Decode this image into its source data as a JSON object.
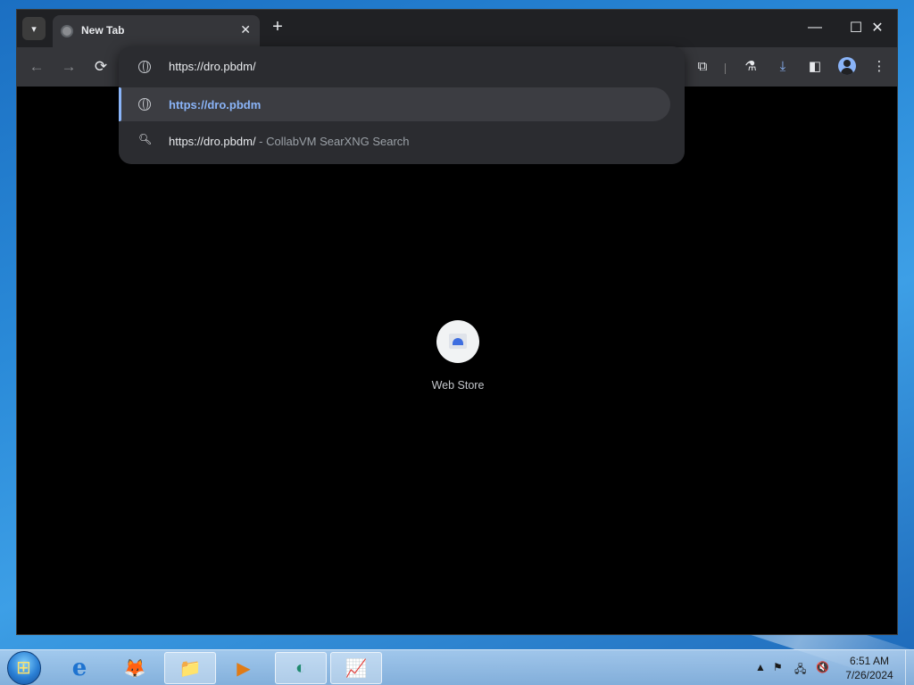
{
  "browser": {
    "tab": {
      "title": "New Tab",
      "close_icon": "✕"
    },
    "new_tab_icon": "+",
    "window_controls": {
      "minimize": "—",
      "maximize": "☐",
      "close": "✕"
    },
    "toolbar": {
      "back": "←",
      "forward": "→",
      "reload": "⟳",
      "extensions_icon": "⧉",
      "labs_icon": "⚗",
      "download_icon": "⤓",
      "side_panel_icon": "◧",
      "menu_icon": "⋮"
    },
    "omnibox": {
      "input_value": "https://dro.pbdm/",
      "suggestions": [
        {
          "text": "https://dro.pbdm",
          "icon": "globe-icon"
        },
        {
          "text": "https://dro.pbdm/",
          "tail": " - CollabVM SearXNG Search",
          "icon": "search-icon"
        }
      ]
    },
    "shortcuts": [
      {
        "label": "Web Store"
      }
    ]
  },
  "taskbar": {
    "apps": [
      {
        "name": "Internet Explorer",
        "glyph": "e",
        "open": false
      },
      {
        "name": "Firefox",
        "glyph": "🦊",
        "open": false
      },
      {
        "name": "File Explorer",
        "glyph": "📁",
        "open": true
      },
      {
        "name": "Media Player",
        "glyph": "▶",
        "open": false
      },
      {
        "name": "Browser",
        "glyph": "◐",
        "open": true
      },
      {
        "name": "Task Manager",
        "glyph": "📈",
        "open": true
      }
    ],
    "tray": {
      "show_hidden": "▲",
      "flag": "⚑",
      "network": "🖧",
      "volume": "🔇"
    },
    "clock": {
      "time": "6:51 AM",
      "date": "7/26/2024"
    }
  },
  "colors": {
    "accent": "#8ab4f8",
    "chrome_dark": "#202124",
    "toolbar": "#35363a"
  }
}
